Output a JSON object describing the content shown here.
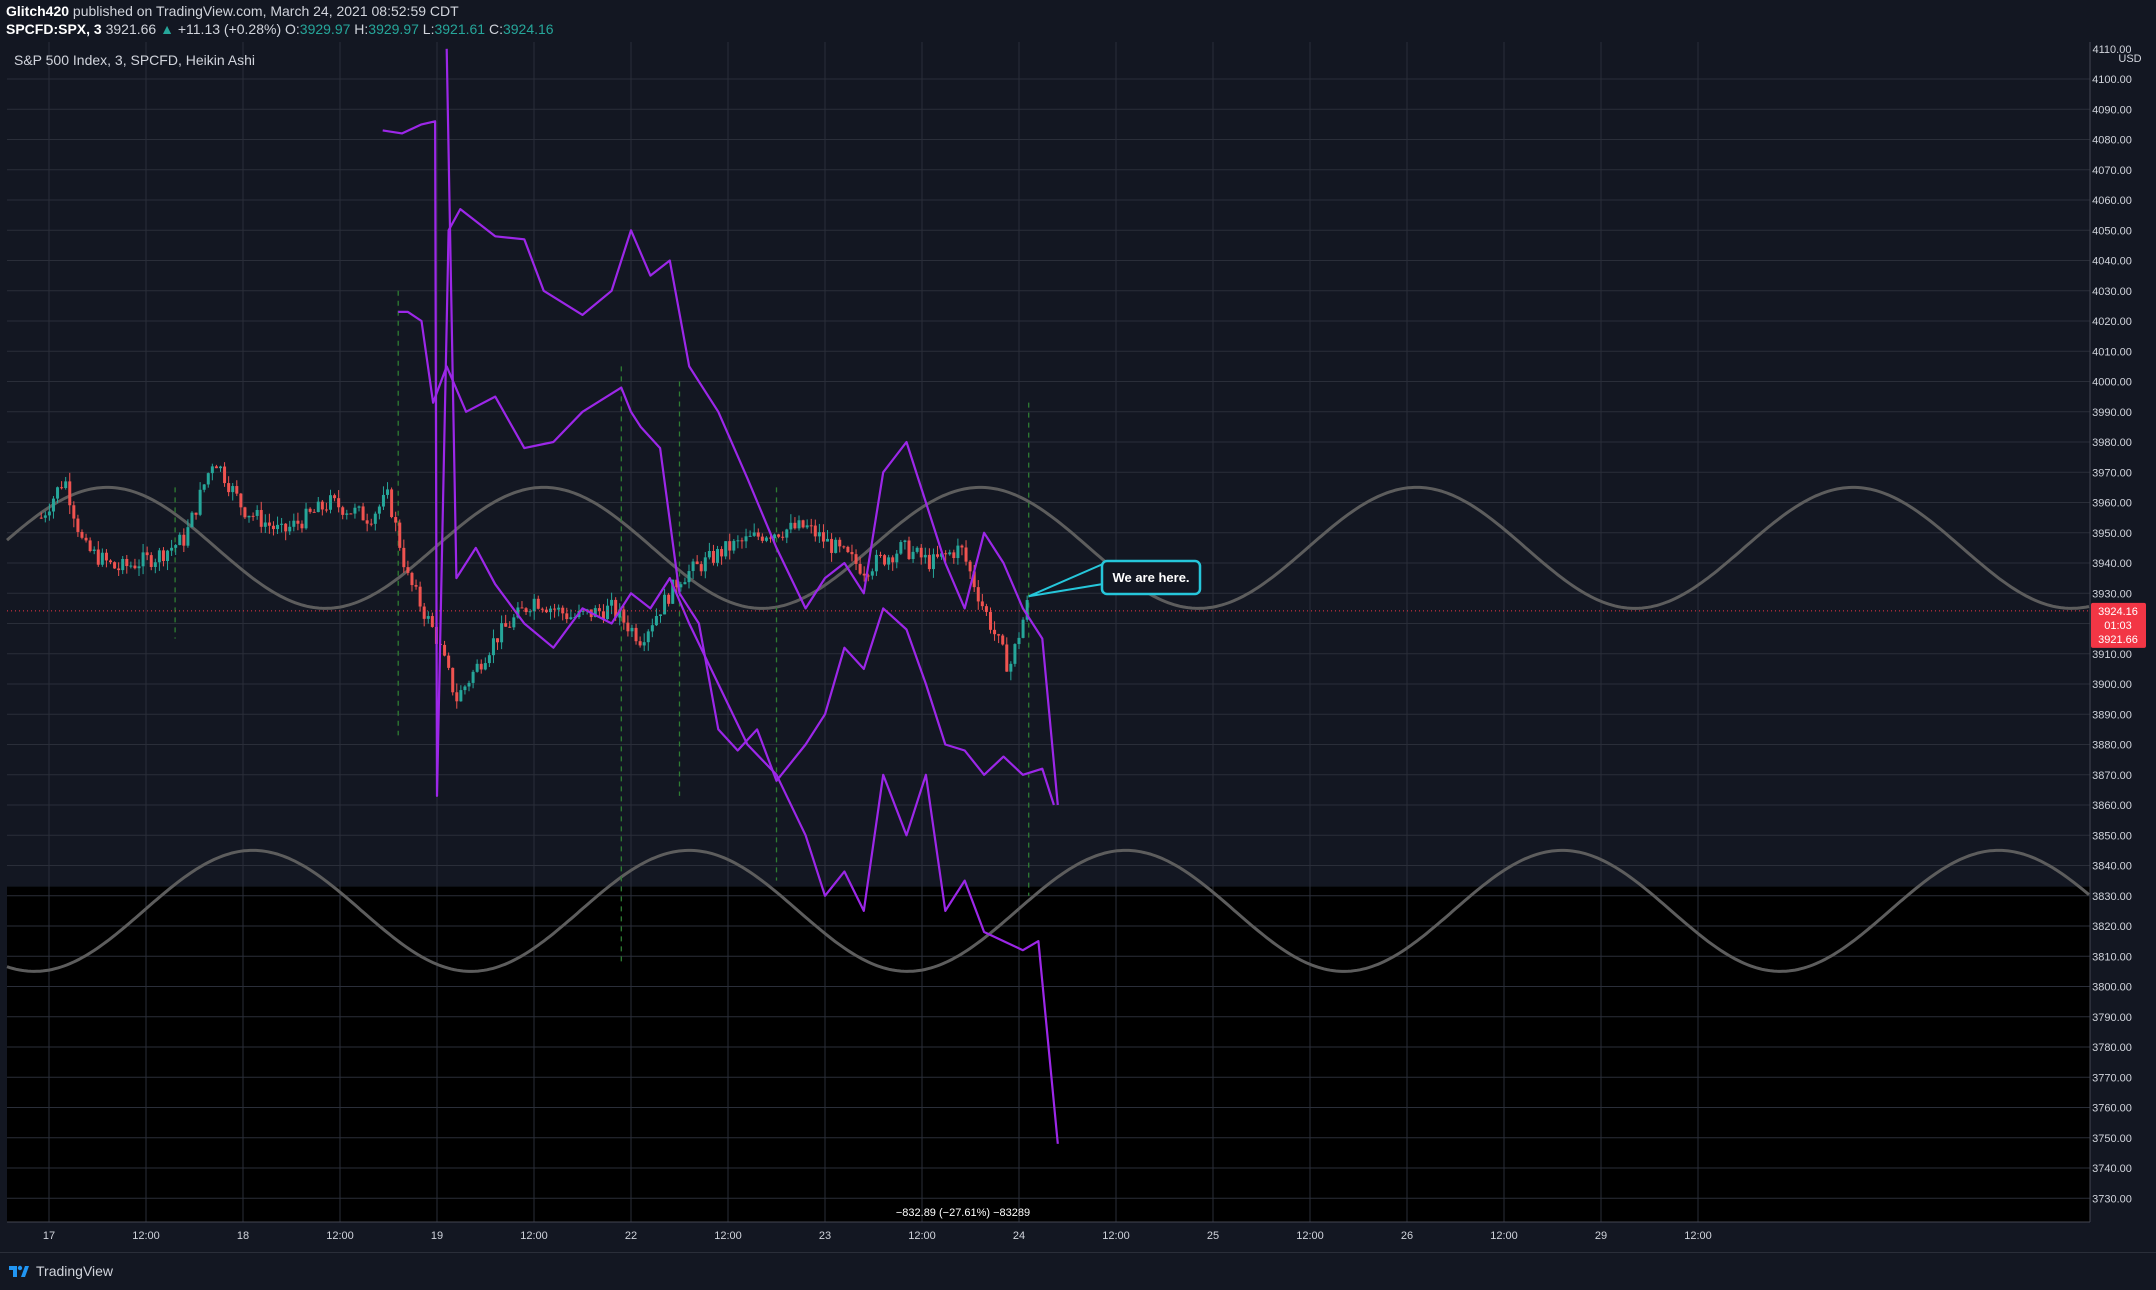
{
  "header": {
    "publisher": "Glitch420",
    "published_text": "published on TradingView.com, March 24, 2021 08:52:59 CDT",
    "symbol": "SPCFD:SPX, 3",
    "last": "3921.66",
    "change": "+11.13 (+0.28%)",
    "o_label": "O:",
    "o_value": "3929.97",
    "h_label": "H:",
    "h_value": "3929.97",
    "l_label": "L:",
    "l_value": "3921.61",
    "c_label": "C:",
    "c_value": "3924.16"
  },
  "footer": {
    "brand": "TradingView"
  },
  "colors": {
    "background": "#131722",
    "lower_band": "#000000",
    "grid": "#2a2e39",
    "projection": "#9c27e8",
    "sine": "#5d5d5d",
    "candle_up": "#26a69a",
    "candle_down": "#ef5350",
    "callout": "#26c6da",
    "price_tag": "#f23645",
    "vertical_marker": "#2e7d32"
  },
  "chart_data": {
    "type": "line",
    "title": "S&P 500 Index, 3, SPCFD, Heikin Ashi",
    "currency": "USD",
    "y_ticks": [
      4100,
      4090,
      4080,
      4070,
      4060,
      4050,
      4040,
      4030,
      4020,
      4010,
      4000,
      3990,
      3980,
      3970,
      3960,
      3950,
      3940,
      3930,
      3920,
      3910,
      3900,
      3890,
      3880,
      3870,
      3860,
      3850,
      3840,
      3830,
      3820,
      3810,
      3800,
      3790,
      3780,
      3770,
      3760,
      3750,
      3740,
      3730
    ],
    "y_partial_top": "4110.00",
    "ylim": [
      3720,
      4112
    ],
    "x_labels": [
      "17",
      "12:00",
      "18",
      "12:00",
      "19",
      "12:00",
      "22",
      "12:00",
      "23",
      "12:00",
      "24",
      "12:00",
      "25",
      "12:00",
      "26",
      "12:00",
      "29",
      "12:00"
    ],
    "x_positions": [
      0,
      0.5,
      1,
      1.5,
      2,
      2.5,
      3,
      3.5,
      4,
      4.5,
      5,
      5.5,
      6,
      6.5,
      7,
      7.5,
      8,
      8.5
    ],
    "xlim": [
      -0.12,
      10.1
    ],
    "current_price": {
      "top": "3924.16",
      "time": "01:03",
      "bottom": "3921.66",
      "value": 3924.16,
      "close": 3921.66
    },
    "measure_label": "−832.89 (−27.61%) −83289",
    "callout_text": "We are here.",
    "callout_anchor": {
      "x": 5.05,
      "y": 3929
    },
    "band_top_value": 3833,
    "sine_waves": [
      {
        "name": "upper",
        "center": 3945,
        "amplitude": 20,
        "period": 2.25,
        "peak_x": 0.3
      },
      {
        "name": "lower",
        "center": 3825,
        "amplitude": 20,
        "period": 2.25,
        "peak_x": 1.05
      }
    ],
    "vertical_markers": [
      {
        "x": 0.65,
        "y1": 3965,
        "y2": 3915
      },
      {
        "x": 1.8,
        "y1": 4030,
        "y2": 3883
      },
      {
        "x": 2.95,
        "y1": 4005,
        "y2": 3808
      },
      {
        "x": 3.25,
        "y1": 4000,
        "y2": 3863
      },
      {
        "x": 3.75,
        "y1": 3965,
        "y2": 3835
      },
      {
        "x": 5.05,
        "y1": 3993,
        "y2": 3830
      }
    ],
    "series": [
      {
        "name": "",
        "x": [
          1.72,
          1.82,
          1.92,
          1.99,
          2.0,
          2.06,
          2.12,
          2.3,
          2.45,
          2.55,
          2.75,
          2.9,
          3.0,
          3.1,
          3.2,
          3.3,
          3.45,
          3.6,
          3.75,
          3.9,
          4.0,
          4.1,
          4.2,
          4.3,
          4.42,
          4.52,
          4.62,
          4.72,
          4.82,
          4.92,
          5.02,
          5.12,
          5.2
        ],
        "y": [
          4083,
          4082,
          4085,
          4086,
          3863,
          4050,
          4057,
          4048,
          4047,
          4030,
          4022,
          4030,
          4050,
          4035,
          4040,
          4005,
          3990,
          3968,
          3945,
          3925,
          3935,
          3940,
          3930,
          3970,
          3980,
          3960,
          3940,
          3925,
          3950,
          3940,
          3925,
          3915,
          3860
        ]
      },
      {
        "name": "",
        "x": [
          1.8,
          1.85,
          1.92,
          1.98,
          2.05,
          2.15,
          2.3,
          2.45,
          2.6,
          2.75,
          2.95,
          3.0,
          3.05,
          3.15,
          3.25,
          3.35,
          3.45,
          3.55,
          3.65,
          3.75,
          3.9,
          4.0,
          4.1,
          4.2,
          4.3,
          4.42,
          4.52,
          4.62,
          4.72,
          4.82,
          4.92,
          5.02,
          5.12,
          5.18
        ],
        "y": [
          4023,
          4023,
          4020,
          3993,
          4005,
          3990,
          3995,
          3978,
          3980,
          3990,
          3998,
          3990,
          3985,
          3978,
          3930,
          3920,
          3885,
          3878,
          3885,
          3868,
          3880,
          3890,
          3912,
          3905,
          3925,
          3918,
          3900,
          3880,
          3878,
          3870,
          3876,
          3870,
          3872,
          3860
        ]
      },
      {
        "name": "",
        "x": [
          2.05,
          2.1,
          2.2,
          2.3,
          2.45,
          2.6,
          2.75,
          2.9,
          3.0,
          3.1,
          3.2,
          3.3,
          3.45,
          3.6,
          3.75,
          3.9,
          4.0,
          4.1,
          4.2,
          4.3,
          4.42,
          4.52,
          4.62,
          4.72,
          4.82,
          4.92,
          5.02,
          5.1,
          5.2
        ],
        "y": [
          4110,
          3935,
          3945,
          3933,
          3920,
          3912,
          3925,
          3920,
          3930,
          3925,
          3935,
          3920,
          3900,
          3880,
          3870,
          3850,
          3830,
          3838,
          3825,
          3870,
          3850,
          3870,
          3825,
          3835,
          3818,
          3815,
          3812,
          3815,
          3748
        ]
      }
    ]
  }
}
